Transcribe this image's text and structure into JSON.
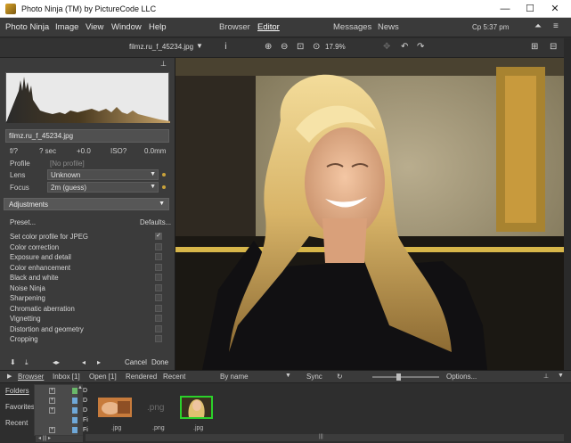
{
  "window": {
    "title": "Photo Ninja (TM) by PictureCode LLC",
    "minimize": "—",
    "maximize": "☐",
    "close": "✕"
  },
  "menu": [
    "Photo Ninja",
    "Image",
    "View",
    "Window",
    "Help"
  ],
  "modes": {
    "browser": "Browser",
    "editor": "Editor",
    "messages": "Messages",
    "news": "News"
  },
  "clock": "Cp 5:37 pm",
  "toolbar": {
    "filename": "filmz.ru_f_45234.jpg",
    "zoom": "17.9%"
  },
  "left": {
    "filename": "filmz.ru_f_45234.jpg",
    "exif": {
      "aperture": "f/?",
      "shutter": "? sec",
      "ev": "+0.0",
      "iso": "ISO?",
      "focal": "0.0mm"
    },
    "profile": {
      "label": "Profile",
      "value": "[No profile]"
    },
    "lens": {
      "label": "Lens",
      "value": "Unknown"
    },
    "focus": {
      "label": "Focus",
      "value": "2m (guess)"
    },
    "adjustments_header": "Adjustments",
    "preset": "Preset...",
    "defaults": "Defaults...",
    "adjustments": [
      "Set color profile for JPEG",
      "Color correction",
      "Exposure and detail",
      "Color enhancement",
      "Black and white",
      "Noise Ninja",
      "Sharpening",
      "Chromatic aberration",
      "Vignetting",
      "Distortion and geometry",
      "Cropping"
    ],
    "cancel": "Cancel",
    "done": "Done"
  },
  "browserbar": {
    "tab": "Browser",
    "inbox": "Inbox [1]",
    "open": "Open [1]",
    "rendered": "Rendered",
    "recent": "Recent",
    "sort": "By name",
    "sync": "Sync",
    "options": "Options..."
  },
  "sidebar": {
    "folders": "Folders",
    "favorites": "Favorites",
    "recent": "Recent"
  },
  "folder_rows": [
    "D",
    "D",
    "D",
    "Fi",
    "Fi"
  ],
  "thumbs": [
    {
      "caption": ".jpg"
    },
    {
      "caption": ".png",
      "placeholder": ".png"
    },
    {
      "caption": ".jpg"
    }
  ],
  "colors": {
    "accent_selected": "#2bd12b",
    "panel": "#3b3b3b",
    "focus_dot": "#c9a23a"
  }
}
